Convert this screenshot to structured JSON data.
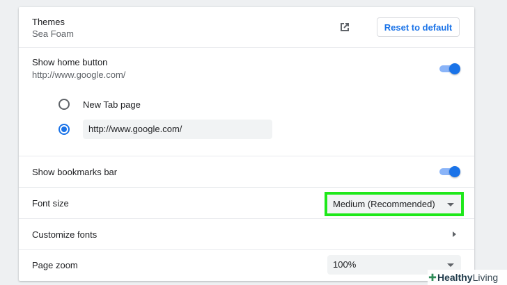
{
  "appearance": {
    "themes": {
      "label": "Themes",
      "value": "Sea Foam",
      "reset_label": "Reset to default"
    },
    "home_button": {
      "label": "Show home button",
      "value": "http://www.google.com/",
      "enabled": true,
      "options": [
        {
          "label": "New Tab page",
          "selected": false
        },
        {
          "label": "",
          "value": "http://www.google.com/",
          "selected": true
        }
      ]
    },
    "bookmarks_bar": {
      "label": "Show bookmarks bar",
      "enabled": true
    },
    "font_size": {
      "label": "Font size",
      "selected": "Medium (Recommended)"
    },
    "customize_fonts": {
      "label": "Customize fonts"
    },
    "page_zoom": {
      "label": "Page zoom",
      "selected": "100%"
    }
  },
  "watermark": {
    "word1": "Healthy",
    "word2": "Living"
  },
  "colors": {
    "accent": "#1a73e8",
    "toggle_track": "#8ab4f8",
    "highlight": "#1ee81a",
    "field_bg": "#f1f3f4"
  },
  "icons": [
    "external-link-icon",
    "chevron-right-icon",
    "dropdown-caret-icon",
    "plus-icon"
  ]
}
